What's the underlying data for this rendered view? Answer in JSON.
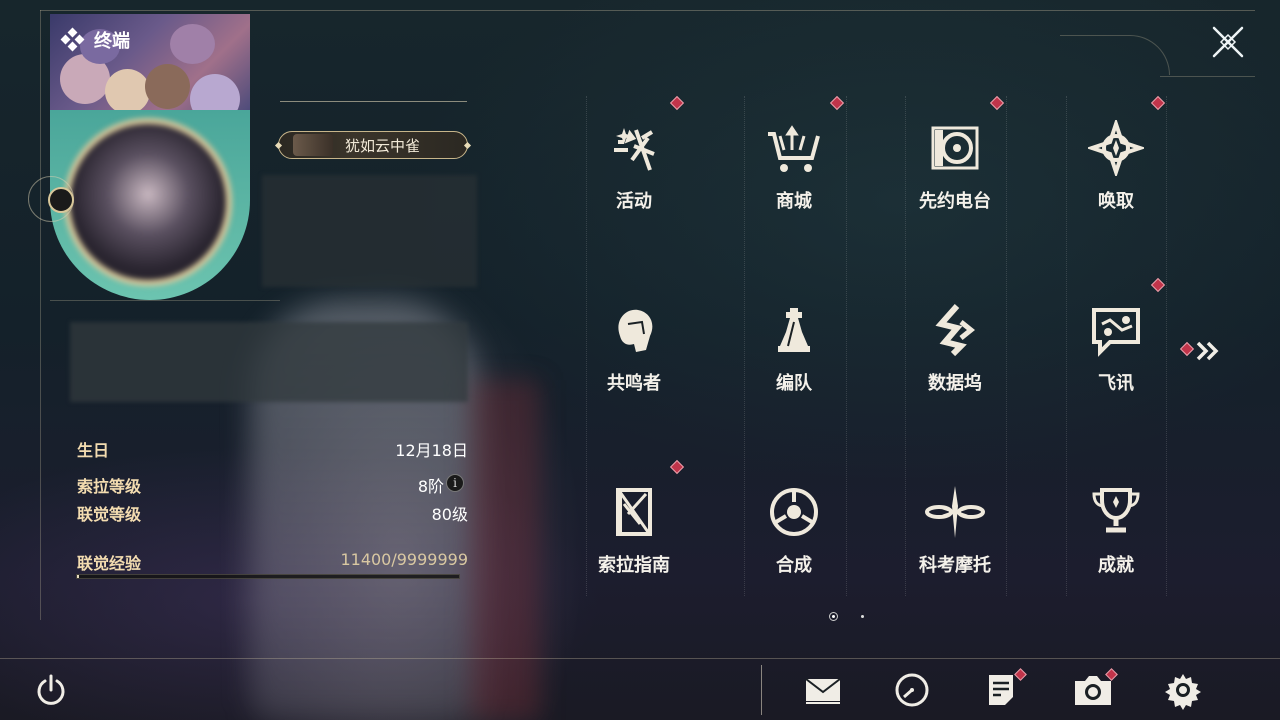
{
  "window": {
    "title": "终端"
  },
  "profile": {
    "name": "犹如云中雀",
    "stats": [
      {
        "label": "生日",
        "value": "12月18日"
      },
      {
        "label": "索拉等级",
        "value": "8阶"
      },
      {
        "label": "联觉等级",
        "value": "80级"
      }
    ],
    "exp": {
      "label": "联觉经验",
      "value": "11400/9999999",
      "current": 11400,
      "max": 9999999
    }
  },
  "menu": {
    "items": [
      {
        "label": "活动",
        "icon": "activity-icon",
        "badge": true
      },
      {
        "label": "商城",
        "icon": "shop-cart-icon",
        "badge": true
      },
      {
        "label": "先约电台",
        "icon": "radio-icon",
        "badge": true
      },
      {
        "label": "唤取",
        "icon": "summon-star-icon",
        "badge": true
      },
      {
        "label": "共鸣者",
        "icon": "resonator-icon",
        "badge": false
      },
      {
        "label": "编队",
        "icon": "team-chess-icon",
        "badge": false
      },
      {
        "label": "数据坞",
        "icon": "data-dock-icon",
        "badge": false
      },
      {
        "label": "飞讯",
        "icon": "message-icon",
        "badge": true
      },
      {
        "label": "索拉指南",
        "icon": "guide-book-icon",
        "badge": true
      },
      {
        "label": "合成",
        "icon": "synthesis-icon",
        "badge": false
      },
      {
        "label": "科考摩托",
        "icon": "motorbike-icon",
        "badge": false
      },
      {
        "label": "成就",
        "icon": "trophy-icon",
        "badge": false
      }
    ],
    "page": 1,
    "page_count": 2
  },
  "bottom_bar": {
    "buttons": [
      {
        "icon": "mail-icon",
        "badge": false
      },
      {
        "icon": "clock-icon",
        "badge": false
      },
      {
        "icon": "notice-icon",
        "badge": true
      },
      {
        "icon": "camera-icon",
        "badge": true
      },
      {
        "icon": "settings-gear-icon",
        "badge": false
      }
    ]
  },
  "colors": {
    "accent_gold": "#d8c79a",
    "badge_red": "#c1344a",
    "label_gold": "#f3dcb0"
  }
}
